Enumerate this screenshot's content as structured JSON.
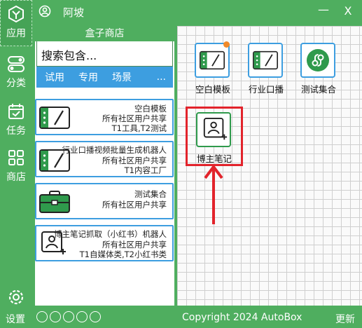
{
  "window": {
    "title": "阿坡",
    "minimize_label": "—",
    "close_label": "X"
  },
  "nav": {
    "items": [
      {
        "label": "应用",
        "icon": "cube-icon",
        "active": true
      },
      {
        "label": "分类",
        "icon": "toggle-icon"
      },
      {
        "label": "任务",
        "icon": "calendar-check-icon"
      },
      {
        "label": "商店",
        "icon": "grid-icon"
      }
    ],
    "settings_label": "设置"
  },
  "store": {
    "title": "盒子商店",
    "search_placeholder": "搜索包含...",
    "filters": [
      "试用",
      "专用",
      "场景",
      "..."
    ],
    "cards": [
      {
        "title": "空白模板",
        "line2": "所有社区用户共享",
        "line3": "T1工具,T2测试",
        "icon": "slash-panel-icon"
      },
      {
        "title": "行业口播视频批量生成机器人",
        "line2": "所有社区用户共享",
        "line3": "T1内容工厂",
        "icon": "slash-panel-icon"
      },
      {
        "title": "测试集合",
        "line2": "所有社区用户共享",
        "line3": "",
        "icon": "toolbox-icon"
      },
      {
        "title": "博主笔记抓取（小红书）机器人",
        "line2": "所有社区用户共享",
        "line3": "T1自媒体类,T2小红书类",
        "icon": "add-user-icon"
      }
    ]
  },
  "workspace": {
    "apps": [
      {
        "label": "空白模板",
        "icon": "slash-panel-icon",
        "badge": true
      },
      {
        "label": "行业口播",
        "icon": "slash-panel-icon"
      },
      {
        "label": "测试集合",
        "icon": "link-circle-icon"
      },
      {
        "label": "博主笔记",
        "icon": "add-user-icon",
        "highlighted": true
      }
    ]
  },
  "footer": {
    "copyright": "Copyright  2024   AutoBox",
    "update_label": "更新",
    "page_dots": 5
  },
  "colors": {
    "brand_green": "#4fae5f",
    "accent_blue": "#3d9ee0",
    "highlight_red": "#e2232b",
    "badge_orange": "#f08a2a"
  }
}
